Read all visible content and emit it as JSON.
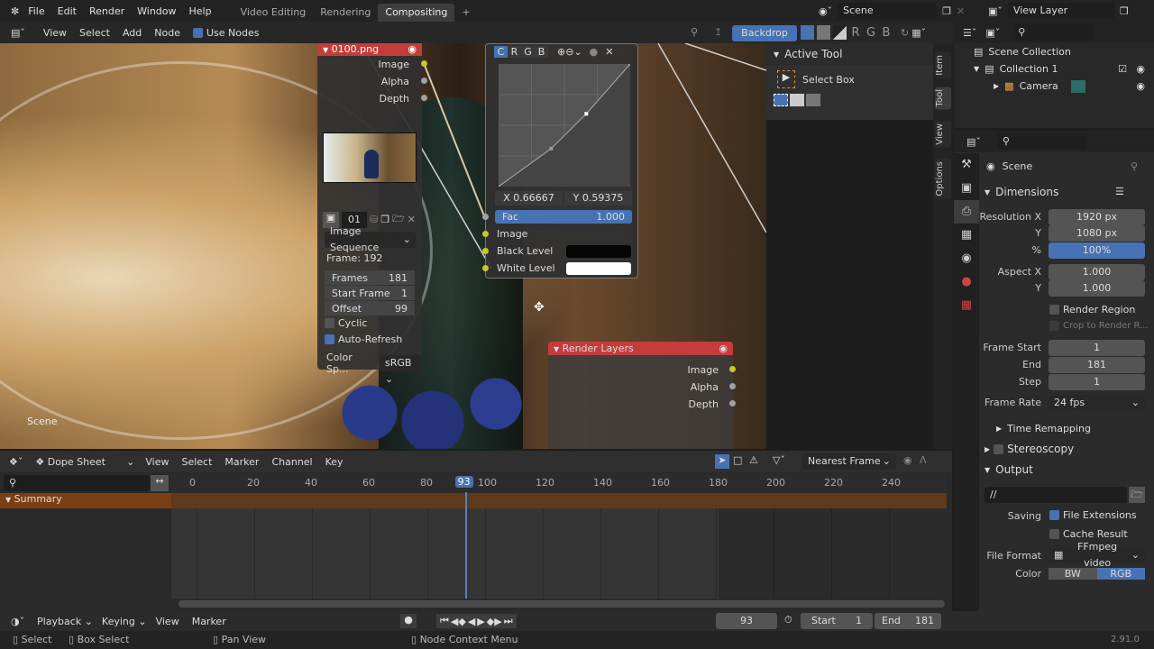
{
  "topbar": {
    "menus": [
      "File",
      "Edit",
      "Render",
      "Window",
      "Help"
    ],
    "workspaces": [
      "Video Editing",
      "Rendering",
      "Compositing"
    ],
    "active_workspace": "Compositing",
    "scene": "Scene",
    "view_layer": "View Layer"
  },
  "node_header": {
    "menus": [
      "View",
      "Select",
      "Add",
      "Node"
    ],
    "use_nodes": "Use Nodes",
    "use_nodes_checked": true,
    "backdrop": "Backdrop",
    "channels": [
      "R",
      "G",
      "B"
    ]
  },
  "image_node": {
    "title": "0100.png",
    "outputs": [
      "Image",
      "Alpha",
      "Depth"
    ],
    "image_id": "01",
    "source": "Image Sequence",
    "frame": "Frame: 192",
    "fields": [
      {
        "label": "Frames",
        "value": "181"
      },
      {
        "label": "Start Frame",
        "value": "1"
      },
      {
        "label": "Offset",
        "value": "99"
      }
    ],
    "cyclic": "Cyclic",
    "cyclic_checked": false,
    "auto_refresh": "Auto-Refresh",
    "auto_refresh_checked": true,
    "color_space_label": "Color Sp...",
    "color_space": "sRGB"
  },
  "curves_node": {
    "channels": [
      "C",
      "R",
      "G",
      "B"
    ],
    "active_channel": "C",
    "x_readout": "X 0.66667",
    "y_readout": "Y 0.59375",
    "fac_label": "Fac",
    "fac_value": "1.000",
    "fac": 1.0,
    "inputs": [
      "Image",
      "Black Level",
      "White Level"
    ],
    "curve_points": [
      [
        0,
        0
      ],
      [
        0.4,
        0.31
      ],
      [
        0.66667,
        0.59375
      ],
      [
        1,
        1
      ]
    ]
  },
  "render_layers_node": {
    "title": "Render Layers",
    "outputs": [
      "Image",
      "Alpha",
      "Depth"
    ]
  },
  "editor_label": "Scene",
  "npanel": {
    "tabs": [
      "Item",
      "Tool",
      "View",
      "Options"
    ],
    "section": "Active Tool",
    "tool": "Select Box"
  },
  "outliner": {
    "items": [
      {
        "label": "Scene Collection"
      },
      {
        "label": "Collection 1"
      },
      {
        "label": "Camera"
      }
    ]
  },
  "properties": {
    "context": "Scene",
    "dimensions": "Dimensions",
    "resolution_x_label": "Resolution X",
    "resolution_x": "1920 px",
    "y_label": "Y",
    "resolution_y": "1080 px",
    "percent_label": "%",
    "percent": "100%",
    "aspect_x_label": "Aspect X",
    "aspect_x": "1.000",
    "aspect_y": "1.000",
    "render_region": "Render Region",
    "crop": "Crop to Render R...",
    "frame_start_label": "Frame Start",
    "frame_start": "1",
    "end_label": "End",
    "frame_end": "181",
    "step_label": "Step",
    "step": "1",
    "frame_rate_label": "Frame Rate",
    "frame_rate": "24 fps",
    "time_remapping": "Time Remapping",
    "stereoscopy": "Stereoscopy",
    "output": "Output",
    "output_path": "//",
    "saving_label": "Saving",
    "file_extensions": "File Extensions",
    "cache_result": "Cache Result",
    "file_format_label": "File Format",
    "file_format": "FFmpeg video",
    "color_label": "Color",
    "color_modes": [
      "BW",
      "RGB"
    ],
    "active_color_mode": "RGB"
  },
  "dopesheet": {
    "mode": "Dope Sheet",
    "menus": [
      "View",
      "Select",
      "Marker",
      "Channel",
      "Key"
    ],
    "snap": "Nearest Frame",
    "ticks": [
      0,
      20,
      40,
      60,
      80,
      100,
      120,
      140,
      160,
      180,
      200,
      220,
      240
    ],
    "current_frame": 93,
    "current_frame_label": "93",
    "summary": "Summary"
  },
  "timeline": {
    "menus": [
      "Playback",
      "Keying",
      "View",
      "Marker"
    ],
    "frame": "93",
    "start_label": "Start",
    "start": "1",
    "end_label": "End",
    "end": "181"
  },
  "status": {
    "items": [
      "Select",
      "Box Select",
      "Pan View",
      "Node Context Menu"
    ],
    "version": "2.91.0"
  },
  "colors": {
    "accent": "#4772b3",
    "node_header_red": "#c43c3c",
    "summary_orange": "#7a3f12",
    "socket_yellow": "#c7c729"
  }
}
